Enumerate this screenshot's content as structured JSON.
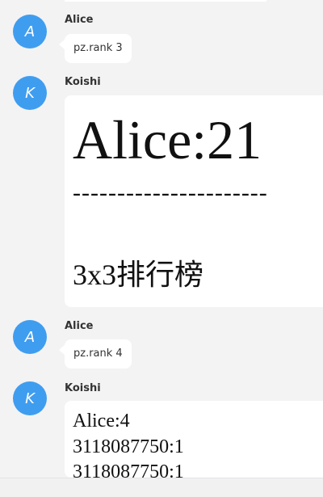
{
  "messages": [
    {
      "sender": "Alice",
      "avatar_letter": "A",
      "text": "pz.rank 3"
    },
    {
      "sender": "Koishi",
      "avatar_letter": "K",
      "card_title": "Alice:21",
      "card_divider": "----------------------",
      "card_footer": "3x3排行榜"
    },
    {
      "sender": "Alice",
      "avatar_letter": "A",
      "text": "pz.rank 4"
    },
    {
      "sender": "Koishi",
      "avatar_letter": "K",
      "card_lines": [
        "Alice:4",
        "3118087750:1",
        "3118087750:1"
      ]
    }
  ],
  "colors": {
    "avatar": "#3f9df0",
    "bubble": "#ffffff",
    "background": "#f3f3f4"
  }
}
